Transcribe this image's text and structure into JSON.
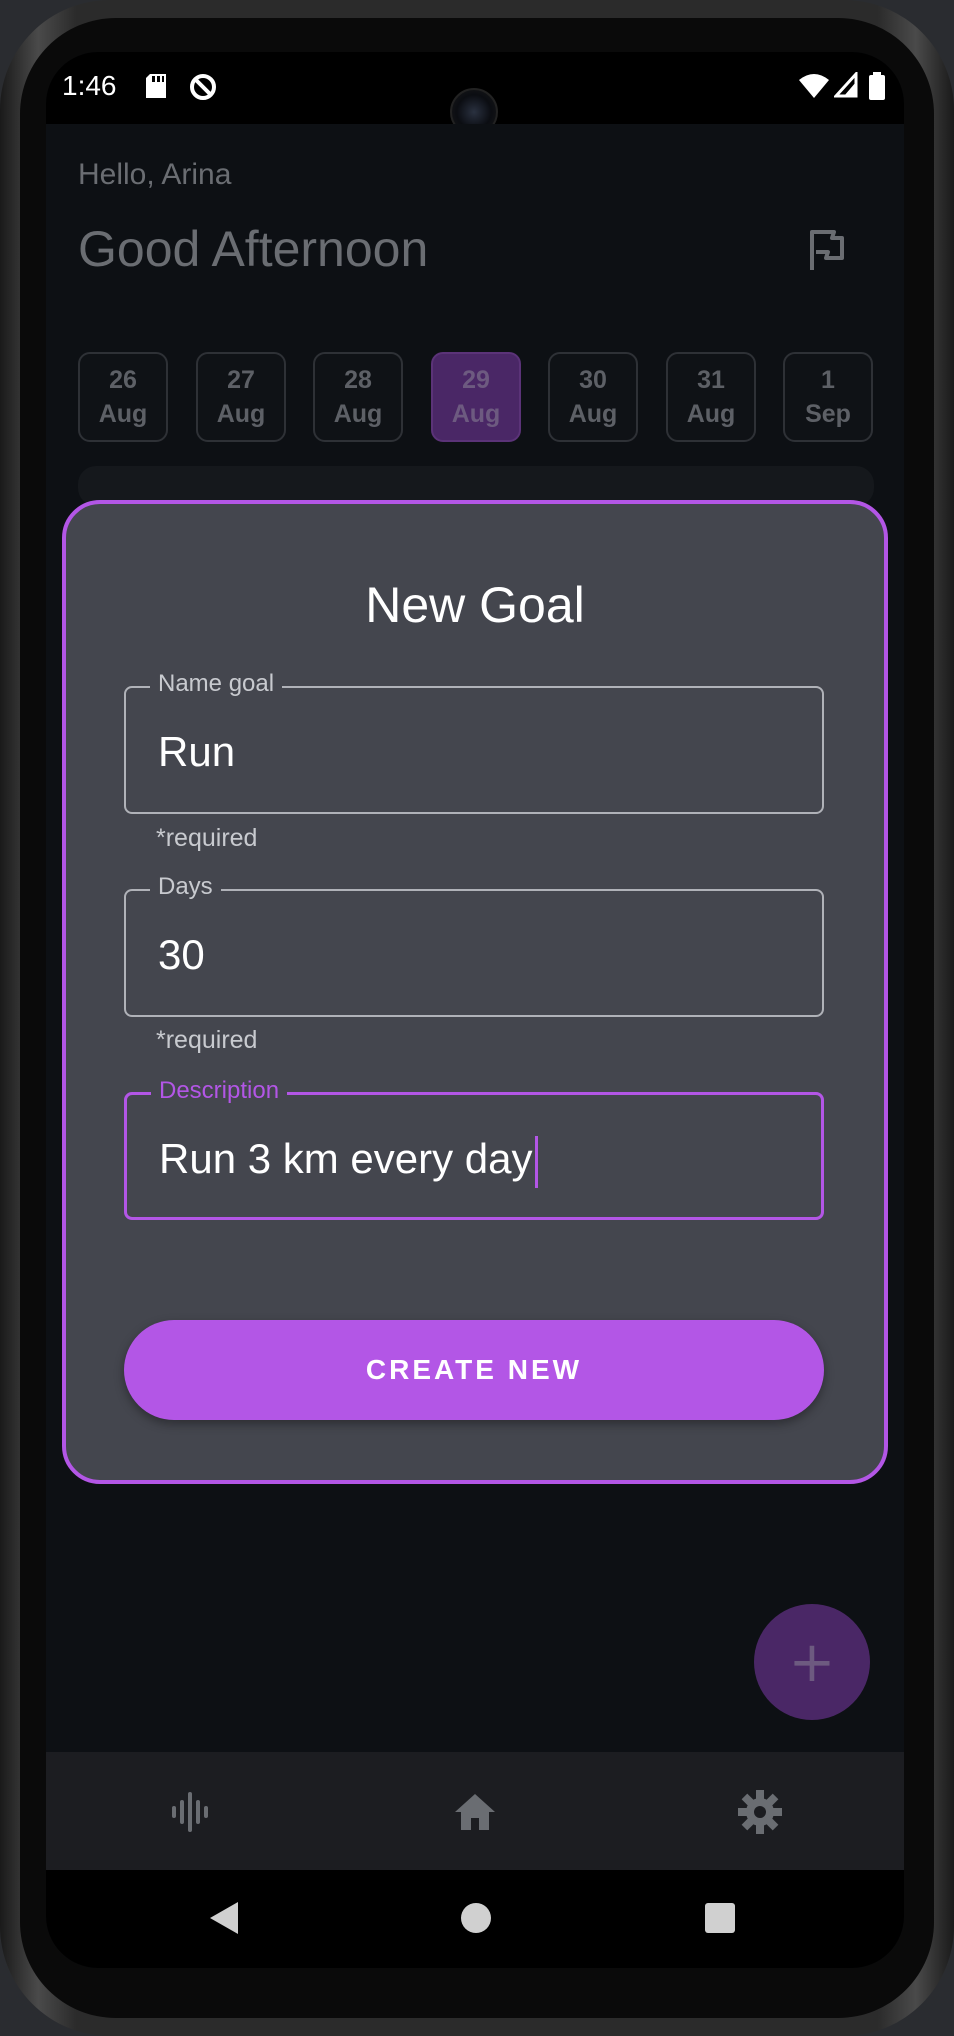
{
  "status_bar": {
    "time": "1:46",
    "icons": [
      "sd-card-icon",
      "sync-icon",
      "wifi-icon",
      "signal-icon",
      "battery-icon"
    ]
  },
  "header": {
    "greeting": "Hello, Arina",
    "headline": "Good Afternoon"
  },
  "dates": [
    {
      "day": "26",
      "month": "Aug",
      "selected": false
    },
    {
      "day": "27",
      "month": "Aug",
      "selected": false
    },
    {
      "day": "28",
      "month": "Aug",
      "selected": false
    },
    {
      "day": "29",
      "month": "Aug",
      "selected": true
    },
    {
      "day": "30",
      "month": "Aug",
      "selected": false
    },
    {
      "day": "31",
      "month": "Aug",
      "selected": false
    },
    {
      "day": "1",
      "month": "Sep",
      "selected": false
    }
  ],
  "dialog": {
    "title": "New Goal",
    "name_field": {
      "label": "Name goal",
      "value": "Run",
      "helper": "*required"
    },
    "days_field": {
      "label": "Days",
      "value": "30",
      "helper": "*required"
    },
    "description_field": {
      "label": "Description",
      "value": "Run 3 km every day"
    },
    "create_label": "CREATE NEW"
  },
  "fab": {
    "label": "+"
  },
  "bottom_nav": {
    "items": [
      {
        "icon": "activity-icon"
      },
      {
        "icon": "home-icon"
      },
      {
        "icon": "settings-icon"
      }
    ]
  },
  "colors": {
    "accent": "#b356e6",
    "dialog_bg": "#44464e",
    "app_bg": "#0d1014"
  }
}
